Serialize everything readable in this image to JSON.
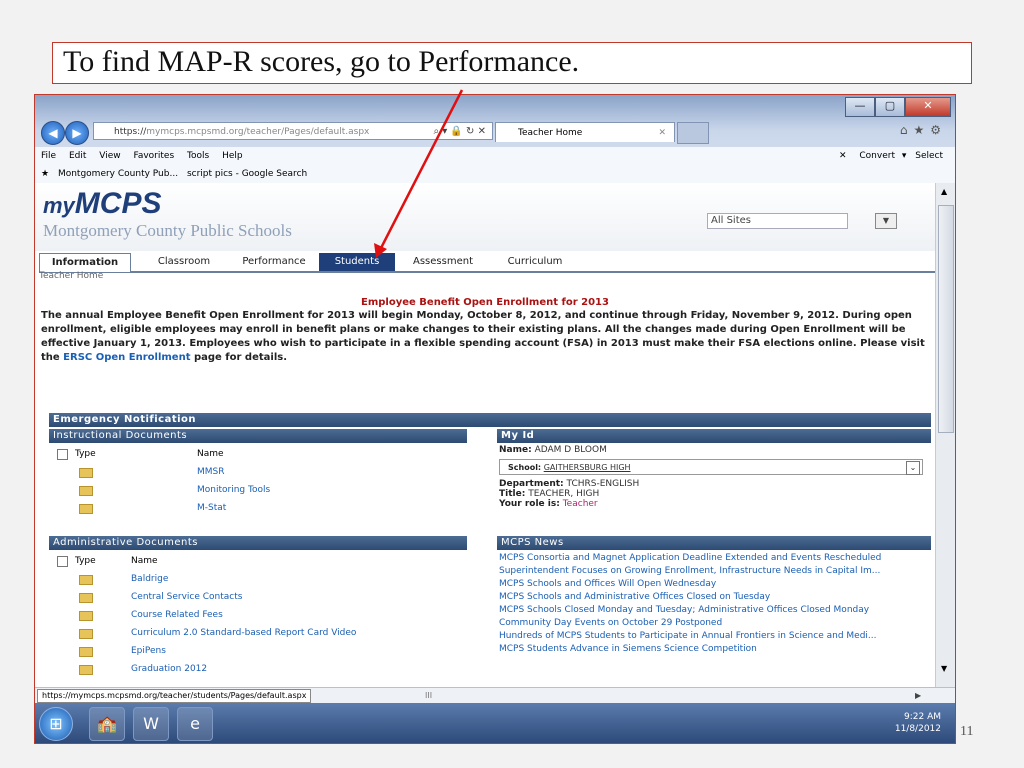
{
  "slide": {
    "title": "To find MAP-R scores, go to Performance.",
    "page_number": "11"
  },
  "browser": {
    "url_prefix": "https://",
    "url_host": "mymcps.mcpsmd.org",
    "url_path": "/teacher/Pages/default.aspx",
    "tab_title": "Teacher Home",
    "menu": [
      "File",
      "Edit",
      "View",
      "Favorites",
      "Tools",
      "Help"
    ],
    "menu_right": [
      "Convert",
      "Select"
    ],
    "favorites": [
      "Montgomery County Pub...",
      "script pics - Google Search"
    ],
    "status_url": "https://mymcps.mcpsmd.org/teacher/students/Pages/default.aspx",
    "scroll_marker": "III"
  },
  "site": {
    "logo_prefix": "my",
    "logo_main": "MCPS",
    "logo_sub": "Montgomery County Public Schools",
    "site_select": "All Sites",
    "tabs": [
      {
        "label": "Information"
      },
      {
        "label": "Classroom"
      },
      {
        "label": "Performance"
      },
      {
        "label": "Students"
      },
      {
        "label": "Assessment"
      },
      {
        "label": "Curriculum"
      }
    ],
    "breadcrumb": "Teacher Home"
  },
  "notice": {
    "title": "Employee Benefit Open Enrollment for 2013",
    "body": "The annual Employee Benefit Open Enrollment for 2013 will begin Monday, October 8, 2012, and continue through Friday, November 9, 2012. During open enrollment, eligible employees may enroll in benefit plans or make changes to their existing plans. All the changes made during Open Enrollment will be effective January 1, 2013. Employees who wish to participate in a flexible spending account (FSA) in 2013 must make their FSA elections online. Please visit the",
    "link": "ERSC Open Enrollment",
    "tail": "page for details."
  },
  "sections": {
    "emergency": "Emergency Notification",
    "instructional": "Instructional Documents",
    "administrative": "Administrative Documents",
    "myid": "My Id",
    "news": "MCPS News",
    "col_type": "Type",
    "col_name": "Name"
  },
  "instructional_docs": [
    "MMSR",
    "Monitoring Tools",
    "M-Stat"
  ],
  "administrative_docs": [
    "Baldrige",
    "Central Service Contacts",
    "Course Related Fees",
    "Curriculum 2.0 Standard-based Report Card Video",
    "EpiPens",
    "Graduation 2012"
  ],
  "my_id": {
    "name_label": "Name:",
    "name": "ADAM D BLOOM",
    "school_label": "School:",
    "school": "GAITHERSBURG HIGH",
    "dept_label": "Department:",
    "dept": "TCHRS-ENGLISH",
    "title_label": "Title:",
    "title": "TEACHER, HIGH",
    "role_label": "Your role is:",
    "role": "Teacher"
  },
  "news": [
    "MCPS Consortia and Magnet Application Deadline Extended and Events Rescheduled",
    "Superintendent Focuses on Growing Enrollment, Infrastructure Needs in Capital Im...",
    "MCPS Schools and Offices Will Open Wednesday",
    "MCPS Schools and Administrative Offices Closed on Tuesday",
    "MCPS Schools Closed Monday and Tuesday; Administrative Offices Closed Monday",
    "Community Day Events on October 29 Postponed",
    "Hundreds of MCPS Students to Participate in Annual Frontiers in Science and Medi...",
    "MCPS Students Advance in Siemens Science Competition"
  ],
  "taskbar": {
    "time": "9:22 AM",
    "date": "11/8/2012"
  },
  "colors": {
    "annotation_red": "#c0392b",
    "nav_active": "#1f3f7a",
    "link": "#1a5fb4"
  }
}
